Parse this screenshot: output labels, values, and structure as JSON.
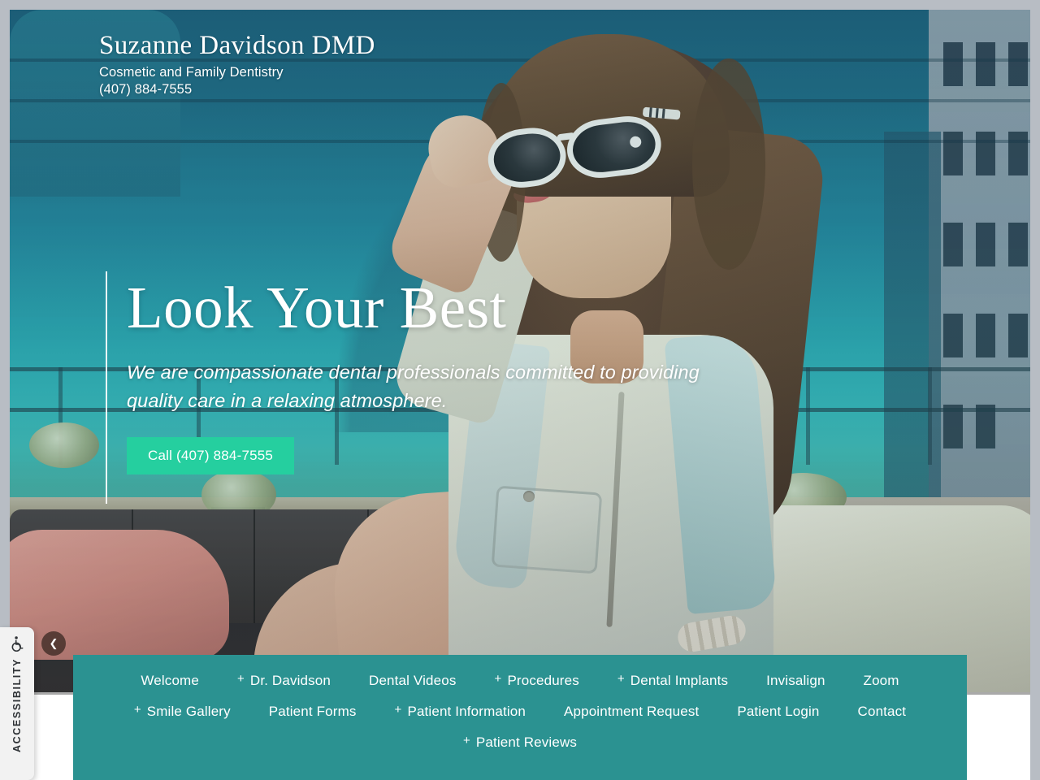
{
  "site": {
    "brand_name": "Suzanne Davidson DMD",
    "tagline": "Cosmetic and Family Dentistry",
    "phone": "(407) 884-7555",
    "accent_teal": "#2b9291",
    "accent_mint": "#25cf9f",
    "hero_sky_top": "#1d5f79",
    "hero_sky_mid": "#2ba2ac"
  },
  "hero": {
    "title": "Look Your Best",
    "subtitle": "We are compassionate dental professionals committed to providing quality care in a relaxing atmosphere.",
    "cta_label": "Call (407) 884-7555",
    "prev_arrow_icon": "chevron-left-icon"
  },
  "nav": {
    "row1": [
      {
        "label": "Welcome",
        "has_submenu": false
      },
      {
        "label": "Dr. Davidson",
        "has_submenu": true
      },
      {
        "label": "Dental Videos",
        "has_submenu": false
      },
      {
        "label": "Procedures",
        "has_submenu": true
      },
      {
        "label": "Dental Implants",
        "has_submenu": true
      },
      {
        "label": "Invisalign",
        "has_submenu": false
      },
      {
        "label": "Zoom",
        "has_submenu": false
      }
    ],
    "row2": [
      {
        "label": "Smile Gallery",
        "has_submenu": true
      },
      {
        "label": "Patient Forms",
        "has_submenu": false
      },
      {
        "label": "Patient Information",
        "has_submenu": true
      },
      {
        "label": "Appointment Request",
        "has_submenu": false
      },
      {
        "label": "Patient Login",
        "has_submenu": false
      },
      {
        "label": "Contact",
        "has_submenu": false
      }
    ],
    "row3": [
      {
        "label": "Patient Reviews",
        "has_submenu": true
      }
    ],
    "submenu_marker": "+"
  },
  "accessibility": {
    "label": "ACCESSIBILITY",
    "icon": "wheelchair-icon"
  }
}
